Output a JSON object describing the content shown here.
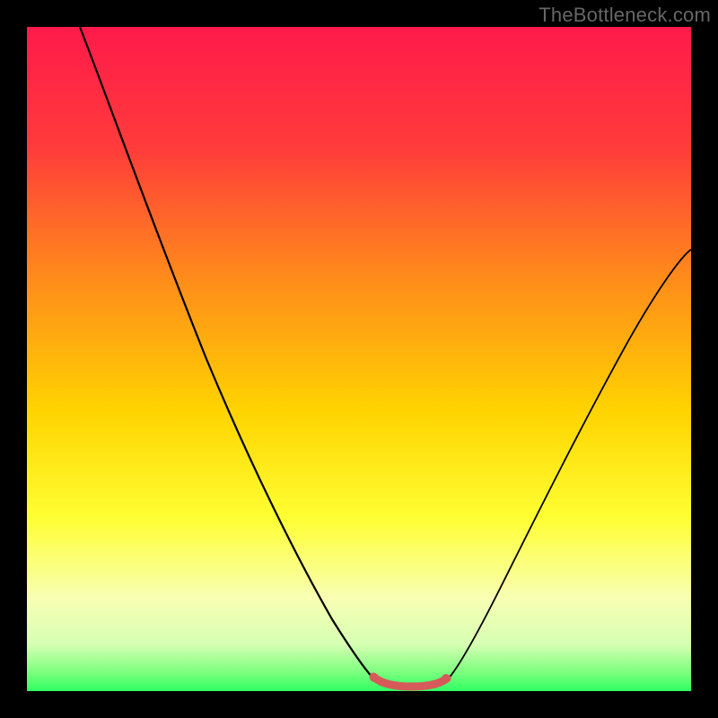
{
  "watermark": "TheBottleneck.com",
  "colors": {
    "frame": "#000000",
    "gradient_top": "#ff1744",
    "gradient_upper_mid": "#ff6d00",
    "gradient_mid": "#ffd600",
    "gradient_lower_mid": "#ffff66",
    "gradient_pale": "#f5ffcc",
    "gradient_bottom": "#2fff62",
    "curve": "#000000",
    "highlight": "#d65a5a"
  },
  "chart_data": {
    "type": "line",
    "title": "",
    "xlabel": "",
    "ylabel": "",
    "xlim": [
      0,
      100
    ],
    "ylim": [
      0,
      100
    ],
    "series": [
      {
        "name": "left-curve",
        "x": [
          8,
          12,
          16,
          20,
          24,
          28,
          32,
          36,
          40,
          44,
          47,
          50,
          52
        ],
        "values": [
          100,
          90,
          79,
          68,
          57,
          46,
          36,
          27,
          19,
          12,
          8,
          4,
          2
        ]
      },
      {
        "name": "right-curve",
        "x": [
          63,
          66,
          70,
          74,
          78,
          82,
          86,
          90,
          94,
          98,
          100
        ],
        "values": [
          2,
          5,
          10,
          16,
          23,
          30,
          38,
          46,
          54,
          62,
          66
        ]
      },
      {
        "name": "bottom-highlight",
        "x": [
          52,
          54,
          56,
          58,
          60,
          62,
          63
        ],
        "values": [
          2,
          1,
          0.8,
          0.8,
          0.8,
          1.2,
          2
        ]
      }
    ],
    "highlight_segment": {
      "x_start": 52,
      "x_end": 63,
      "y": 1.5
    },
    "gradient_stops": [
      {
        "offset": 0,
        "color": "#ff1744"
      },
      {
        "offset": 35,
        "color": "#ff6d00"
      },
      {
        "offset": 60,
        "color": "#ffd600"
      },
      {
        "offset": 80,
        "color": "#ffff66"
      },
      {
        "offset": 90,
        "color": "#f5ffcc"
      },
      {
        "offset": 100,
        "color": "#2fff62"
      }
    ]
  }
}
